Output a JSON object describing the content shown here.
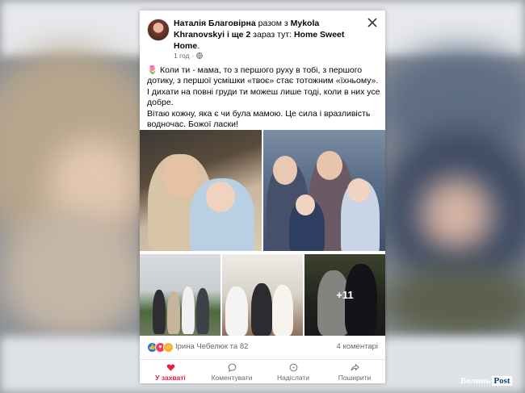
{
  "post": {
    "author": "Наталія Благовірна",
    "with_word": "разом з",
    "tagged": "Mykola Khranovskyi",
    "and_more": "і ще 2",
    "now_at": "зараз тут:",
    "place": "Home Sweet Home",
    "time": "1 год",
    "dot": "·",
    "text_lines": [
      "🌷 Коли ти - мама, то з першого руху в тобі, з першого дотику, з першої усмішки «твоє» стає тотожним «їхньому». І дихати на повні груди ти можеш лише тоді, коли в них усе добре.",
      "Вітаю кожну, яка є чи була мамою. Це сила і вразливість водночас. Божої ласки!"
    ],
    "more_photos": "+11"
  },
  "reactions": {
    "names": "Ірина Чебелюк та 82",
    "comments": "4 коментарі",
    "icons": [
      "like-icon",
      "love-icon",
      "care-icon"
    ]
  },
  "actions": [
    {
      "label": "У захваті",
      "icon": "heart-icon",
      "active": true
    },
    {
      "label": "Коментувати",
      "icon": "comment-icon"
    },
    {
      "label": "Надіслати",
      "icon": "messenger-icon"
    },
    {
      "label": "Поширити",
      "icon": "share-icon"
    }
  ],
  "watermark": {
    "part1": "Волинь",
    "part2": "Post"
  },
  "colors": {
    "accent": "#e41e3f",
    "like": "#1877f2",
    "love": "#f33e58",
    "care": "#f7b125"
  }
}
